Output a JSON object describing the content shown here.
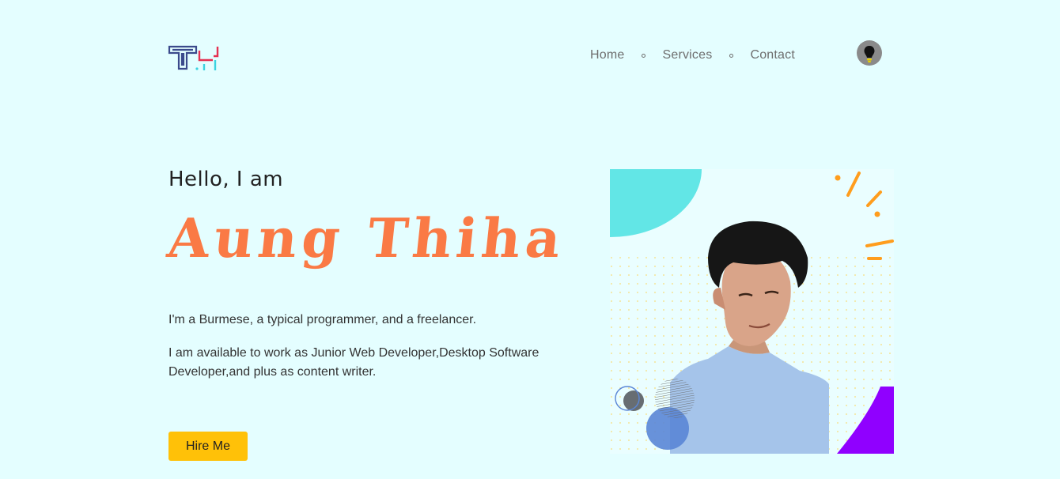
{
  "header": {
    "logo_icon": "th-monogram-logo",
    "nav": [
      {
        "label": "Home"
      },
      {
        "label": "Services"
      },
      {
        "label": "Contact"
      }
    ],
    "theme_toggle_icon": "lightbulb-icon"
  },
  "hero": {
    "greeting": "Hello, I am",
    "name": "Aung Thiha",
    "bio_line_1": "I'm a Burmese, a typical programmer, and a freelancer.",
    "bio_line_2": "I am available to work as Junior Web Developer,Desktop Software Developer,and plus as content writer.",
    "hire_button_label": "Hire Me",
    "portrait": "profile-photo"
  },
  "colors": {
    "background": "#e4feff",
    "name_accent": "#fa7a45",
    "button": "#ffc108",
    "shape_cyan": "#62e6e6",
    "shape_purple": "#9000ff",
    "shape_orange": "#ff9d1d"
  }
}
